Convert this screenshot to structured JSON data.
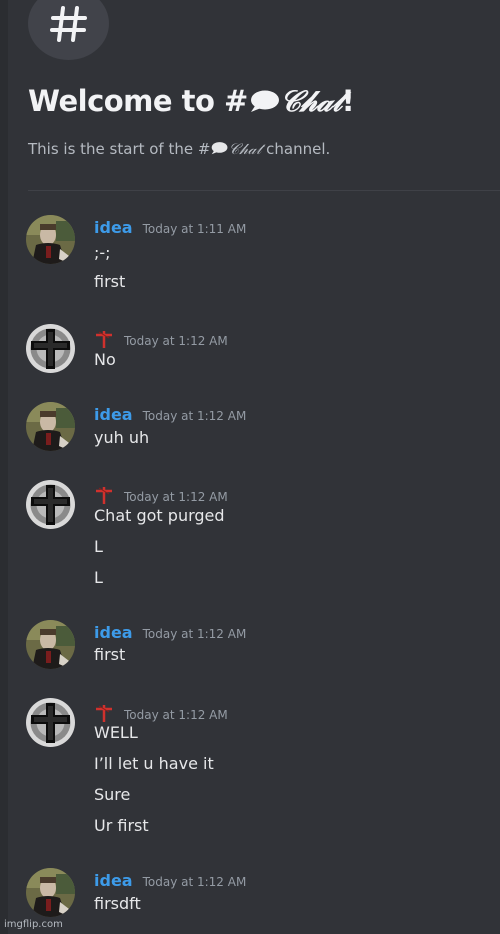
{
  "channel": {
    "hash_icon": "hash-icon",
    "welcome_prefix": "Welcome to #",
    "bubble_icon": "speech-bubble-icon",
    "channel_name_fancy": "𝒞𝒽𝒶𝓉",
    "welcome_suffix": "!",
    "subtitle_prefix": "This is the start of the #",
    "subtitle_suffix": " channel."
  },
  "messages": [
    {
      "user": "idea",
      "time": "Today at 1:11 AM",
      "lines": [
        ";-;",
        "first"
      ]
    },
    {
      "user": "cross",
      "time": "Today at 1:12 AM",
      "lines": [
        "No"
      ]
    },
    {
      "user": "idea",
      "time": "Today at 1:12 AM",
      "lines": [
        "yuh uh"
      ]
    },
    {
      "user": "cross",
      "time": "Today at 1:12 AM",
      "lines": [
        "Chat got purged",
        "L",
        "L"
      ]
    },
    {
      "user": "idea",
      "time": "Today at 1:12 AM",
      "lines": [
        "first"
      ]
    },
    {
      "user": "cross",
      "time": "Today at 1:12 AM",
      "lines": [
        "WELL",
        "I’ll let u have it",
        "Sure",
        "Ur first"
      ]
    },
    {
      "user": "idea",
      "time": "Today at 1:12 AM",
      "lines": [
        "firsdft"
      ]
    }
  ],
  "users": {
    "idea": {
      "name": "idea",
      "color": "#3d9be9"
    },
    "cross": {
      "name": "",
      "color": "#d0312d"
    }
  },
  "watermark": "imgflip.com"
}
